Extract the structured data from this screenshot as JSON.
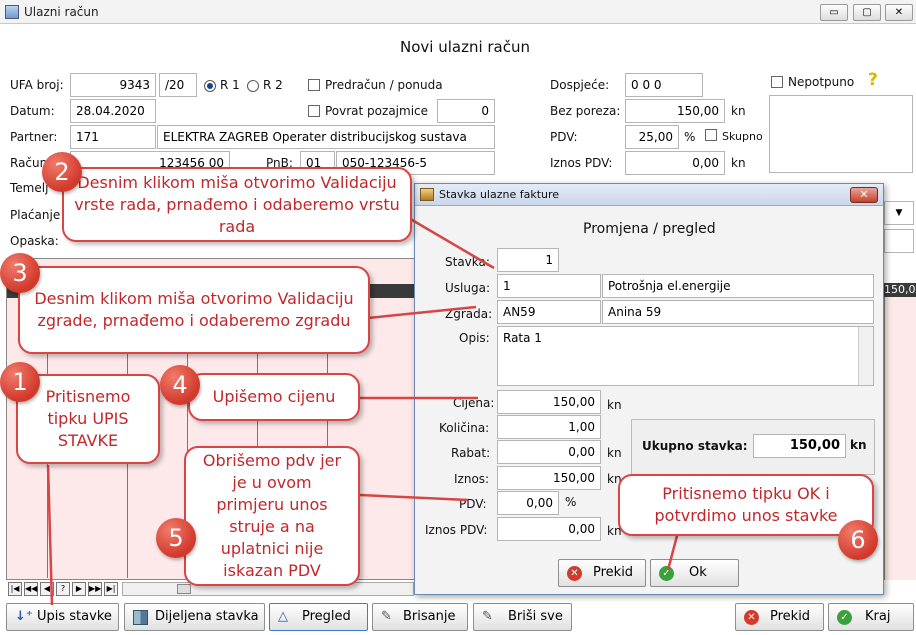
{
  "window": {
    "title": "Ulazni račun",
    "buttons": [
      "▭",
      "▢",
      "✕"
    ]
  },
  "form": {
    "heading": "Novi ulazni račun",
    "ufa_label": "UFA broj:",
    "ufa_value": "9343",
    "ufa_suffix": "/20",
    "r1_label": "R 1",
    "r2_label": "R 2",
    "predracun_label": "Predračun / ponuda",
    "datum_label": "Datum:",
    "datum_value": "28.04.2020",
    "povrat_label": "Povrat pozajmice",
    "povrat_value": "0",
    "partner_label": "Partner:",
    "partner_id": "171",
    "partner_name": "ELEKTRA ZAGREB Operater distribucijskog sustava",
    "racun_label": "Račun",
    "racun_value": "123456 00",
    "pnb_label": "PnB:",
    "pnb_model": "01",
    "pnb_value": "050-123456-5",
    "temelj_label": "Temelj",
    "placanje_label": "Plaćanje",
    "opaska_label": "Opaska:",
    "dospjece_label": "Dospjeće:",
    "dospjece_value": "0 0 0",
    "bez_poreza_label": "Bez poreza:",
    "bez_poreza_value": "150,00",
    "kn": "kn",
    "pdv_label": "PDV:",
    "pdv_value": "25,00",
    "percent": "%",
    "skupno_label": "Skupno",
    "iznos_pdv_label": "Iznos PDV:",
    "iznos_pdv_value": "0,00",
    "nepotpuno_label": "Nepotpuno",
    "help": "?",
    "grid_corner_value": "150,00"
  },
  "toolbar": {
    "upis_stavke": "Upis stavke",
    "dijeljena_stavka": "Dijeljena stavka",
    "pregled": "Pregled",
    "brisanje": "Brisanje",
    "brisi_sve": "Briši sve",
    "prekid": "Prekid",
    "kraj": "Kraj",
    "nav": [
      "|◀",
      "◀◀",
      "◀",
      "?",
      "▶",
      "▶▶",
      "▶|"
    ]
  },
  "dialog": {
    "title": "Stavka ulazne fakture",
    "close": "✕",
    "heading": "Promjena / pregled",
    "stavka_label": "Stavka:",
    "stavka_value": "1",
    "usluga_label": "Usluga:",
    "usluga_code": "1",
    "usluga_name": "Potrošnja el.energije",
    "zgrada_label": "Zgrada:",
    "zgrada_code": "AN59",
    "zgrada_name": "Anina 59",
    "opis_label": "Opis:",
    "opis_value": "Rata 1",
    "cijena_label": "Cijena:",
    "cijena_value": "150,00",
    "kolicina_label": "Količina:",
    "kolicina_value": "1,00",
    "rabat_label": "Rabat:",
    "rabat_value": "0,00",
    "iznos_label": "Iznos:",
    "iznos_value": "150,00",
    "pdv_label": "PDV:",
    "pdv_value": "0,00",
    "iznos_pdv_label": "Iznos PDV:",
    "iznos_pdv_value": "0,00",
    "kn": "kn",
    "percent": "%",
    "ukupno_label": "Ukupno stavka:",
    "ukupno_value": "150,00",
    "prekid": "Prekid",
    "ok": "Ok"
  },
  "callouts": [
    {
      "n": "1",
      "text": "Pritisnemo tipku UPIS STAVKE"
    },
    {
      "n": "2",
      "text": "Desnim klikom miša otvorimo Validaciju vrste rada, prnađemo i odaberemo vrstu rada"
    },
    {
      "n": "3",
      "text": "Desnim klikom miša otvorimo Validaciju zgrade, prnađemo i odaberemo zgradu"
    },
    {
      "n": "4",
      "text": "Upišemo cijenu"
    },
    {
      "n": "5",
      "text": "Obrišemo pdv jer je u ovom primjeru unos struje a na uplatnici nije iskazan PDV"
    },
    {
      "n": "6",
      "text": "Pritisnemo tipku OK i potvrdimo unos stavke"
    }
  ],
  "colors": {
    "accent_red": "#d94545",
    "grid_bg": "#fde9e9"
  }
}
